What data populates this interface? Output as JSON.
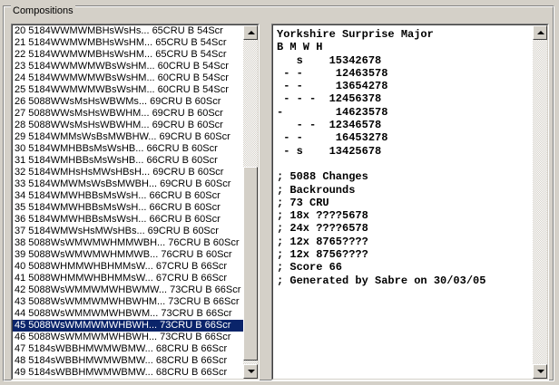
{
  "group": {
    "label": "Compositions"
  },
  "list": {
    "selected_index": 25,
    "items": [
      "20 5184WWMWMBHsWsHs... 65CRU B 54Scr",
      "21 5184WWMWMBHsWsHM... 65CRU B 54Scr",
      "22 5184WWMWMBHsWsHM... 65CRU B 54Scr",
      "23 5184WWMWMWBsWsHM... 60CRU B 54Scr",
      "24 5184WWMWMWBsWsHM... 60CRU B 54Scr",
      "25 5184WWMWMWBsWsHM... 60CRU B 54Scr",
      "26 5088WWsMsHsWBWMs... 69CRU B 60Scr",
      "27 5088WWsMsHsWBWHM... 69CRU B 60Scr",
      "28 5088WWsMsHsWBWHM... 69CRU B 60Scr",
      "29 5184WMMsWsBsMWBHW... 69CRU B 60Scr",
      "30 5184WMHBBsMsWsHB... 66CRU B 60Scr",
      "31 5184WMHBBsMsWsHB... 66CRU B 60Scr",
      "32 5184WMHsHsMWsHBsH... 69CRU B 60Scr",
      "33 5184WMWMsWsBsMWBH... 69CRU B 60Scr",
      "34 5184WMWHBBsMsWsH... 66CRU B 60Scr",
      "35 5184WMWHBBsMsWsH... 66CRU B 60Scr",
      "36 5184WMWHBBsMsWsH... 66CRU B 60Scr",
      "37 5184WMWsHsMWsHBs... 69CRU B 60Scr",
      "38 5088WsWMWMWHMMWBH... 76CRU B 60Scr",
      "39 5088WsWMWMWHMMWB... 76CRU B 60Scr",
      "40 5088WHMMWHBHMMsW... 67CRU B 66Scr",
      "41 5088WHMMWHBHMMsW... 67CRU B 66Scr",
      "42 5088WsWMMWMWHBWMW... 73CRU B 66Scr",
      "43 5088WsWMMWMWHBWHM... 73CRU B 66Scr",
      "44 5088WsWMMWMWHBWM... 73CRU B 66Scr",
      "45 5088WsWMMWMWHBWH... 73CRU B 66Scr",
      "46 5088WsWMMWMWHBWH... 73CRU B 66Scr",
      "47 5184sWBBHMWMWBMW... 68CRU B 66Scr",
      "48 5184sWBBHMWMWBMW... 68CRU B 66Scr",
      "49 5184sWBBHMWMWBMW... 68CRU B 66Scr"
    ]
  },
  "composition": {
    "lines": [
      "Yorkshire Surprise Major",
      "B M W H",
      "   s    15342678",
      " - -     12463578",
      " - -     13654278",
      " - - -  12456378",
      "-        14623578",
      "   - -  12346578",
      " - -     16453278",
      " - s    13425678",
      "",
      "; 5088 Changes",
      "; Backrounds",
      "; 73 CRU",
      "; 18x ????5678",
      "; 24x ????6578",
      "; 12x 8765????",
      "; 12x 8756????",
      "; Score 66",
      "; Generated by Sabre on 30/03/05"
    ]
  },
  "icons": {
    "scroll_up": "arrow-up-icon",
    "scroll_down": "arrow-down-icon"
  },
  "colors": {
    "selection": "#0a246a",
    "window": "#d4d0c8"
  }
}
